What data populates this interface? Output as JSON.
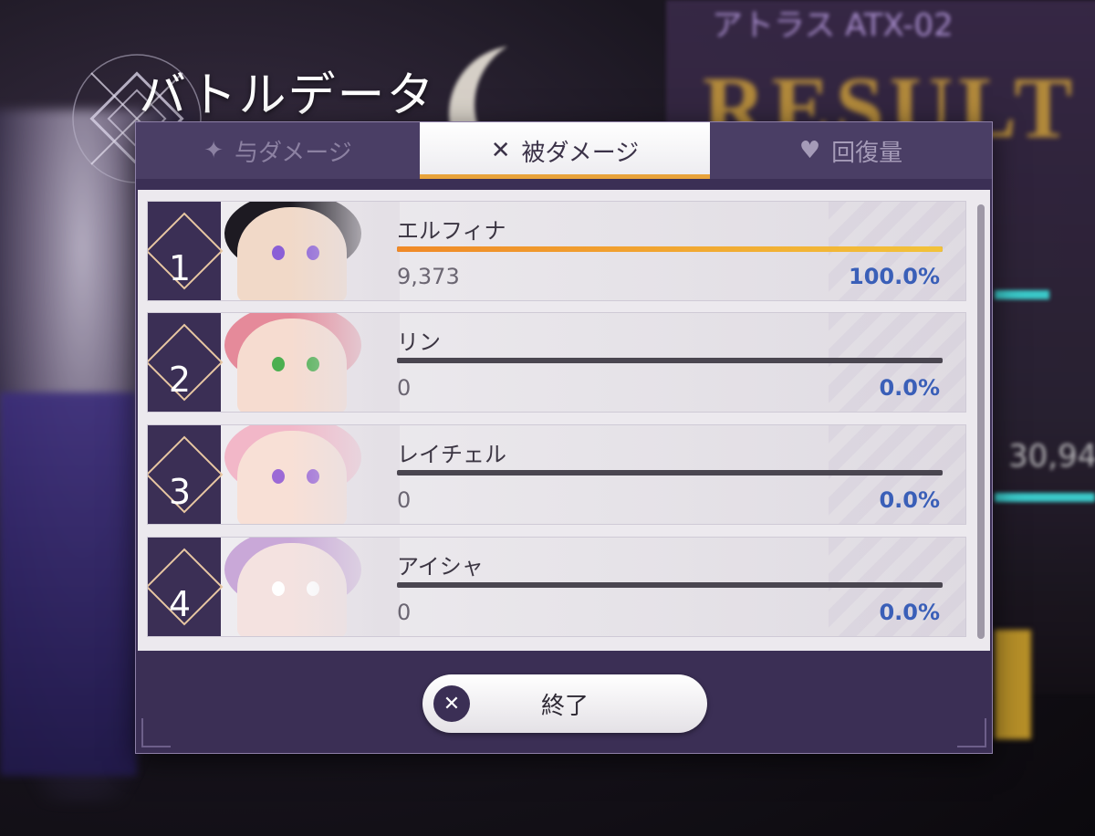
{
  "title": "バトルデータ",
  "background": {
    "result_text": "RESULT",
    "atx_text": "アトラス ATX-02",
    "side_number": "30,94"
  },
  "tabs": [
    {
      "label": "与ダメージ",
      "icon": "sword-sparkle-icon",
      "active": false
    },
    {
      "label": "被ダメージ",
      "icon": "damage-taken-icon",
      "active": true
    },
    {
      "label": "回復量",
      "icon": "heart-icon",
      "active": false
    }
  ],
  "rows": [
    {
      "rank": "1",
      "name": "エルフィナ",
      "value": "9,373",
      "percent": "100.0%",
      "fill": 1.0,
      "hair": "#1d1a22",
      "skin": "#f1d9c8",
      "eye": "#8a5fd6"
    },
    {
      "rank": "2",
      "name": "リン",
      "value": "0",
      "percent": "0.0%",
      "fill": 0.0,
      "hair": "#e58a9a",
      "skin": "#f6dcd0",
      "eye": "#4caf50"
    },
    {
      "rank": "3",
      "name": "レイチェル",
      "value": "0",
      "percent": "0.0%",
      "fill": 0.0,
      "hair": "#f2b7c8",
      "skin": "#f8e0d6",
      "eye": "#9c6ad6"
    },
    {
      "rank": "4",
      "name": "アイシャ",
      "value": "0",
      "percent": "0.0%",
      "fill": 0.0,
      "hair": "#c9a8d8",
      "skin": "#f4e2e0",
      "eye": "#ffffff"
    }
  ],
  "end_button": {
    "label": "終了",
    "icon": "close-icon"
  },
  "colors": {
    "accent": "#e8a33a",
    "panel": "#3b2f55",
    "percent": "#3a5fb8"
  }
}
